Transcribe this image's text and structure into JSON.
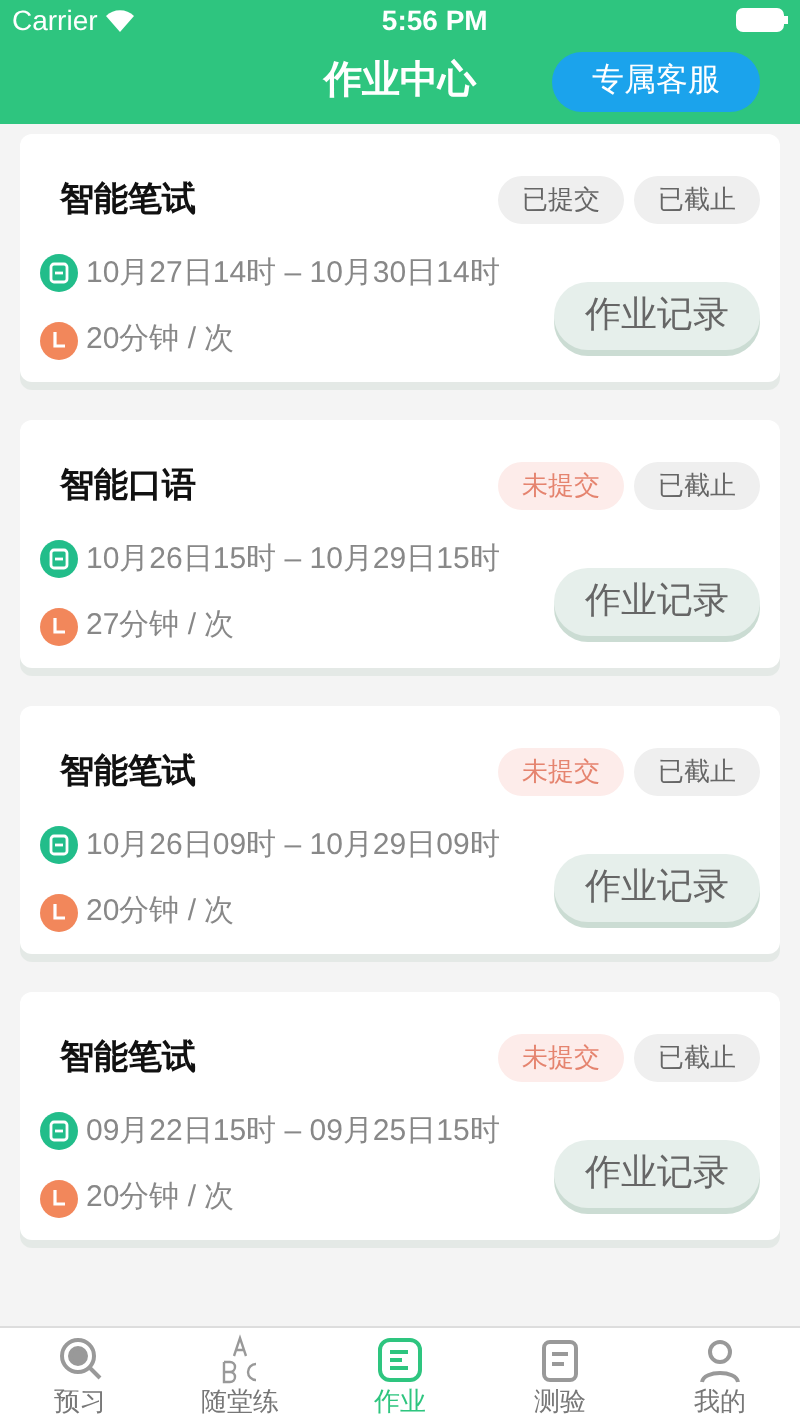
{
  "status_bar": {
    "carrier": "Carrier",
    "time": "5:56 PM"
  },
  "header": {
    "title": "作业中心",
    "service_button": "专属客服"
  },
  "assignments": [
    {
      "title": "智能笔试",
      "tags": [
        {
          "label": "已提交",
          "kind": "done"
        },
        {
          "label": "已截止",
          "kind": "closed"
        }
      ],
      "period": "10月27日14时 – 10月30日14时",
      "duration": "20分钟 / 次",
      "button": "作业记录"
    },
    {
      "title": "智能口语",
      "tags": [
        {
          "label": "未提交",
          "kind": "pending"
        },
        {
          "label": "已截止",
          "kind": "closed"
        }
      ],
      "period": "10月26日15时 – 10月29日15时",
      "duration": "27分钟 / 次",
      "button": "作业记录"
    },
    {
      "title": "智能笔试",
      "tags": [
        {
          "label": "未提交",
          "kind": "pending"
        },
        {
          "label": "已截止",
          "kind": "closed"
        }
      ],
      "period": "10月26日09时 – 10月29日09时",
      "duration": "20分钟 / 次",
      "button": "作业记录"
    },
    {
      "title": "智能笔试",
      "tags": [
        {
          "label": "未提交",
          "kind": "pending"
        },
        {
          "label": "已截止",
          "kind": "closed"
        }
      ],
      "period": "09月22日15时 – 09月25日15时",
      "duration": "20分钟 / 次",
      "button": "作业记录"
    }
  ],
  "tab_bar": [
    {
      "label": "预习",
      "kind": "preview",
      "selected": false
    },
    {
      "label": "随堂练",
      "kind": "abc",
      "selected": false
    },
    {
      "label": "作业",
      "kind": "homework",
      "selected": true
    },
    {
      "label": "测验",
      "kind": "test",
      "selected": false
    },
    {
      "label": "我的",
      "kind": "profile",
      "selected": false
    }
  ]
}
